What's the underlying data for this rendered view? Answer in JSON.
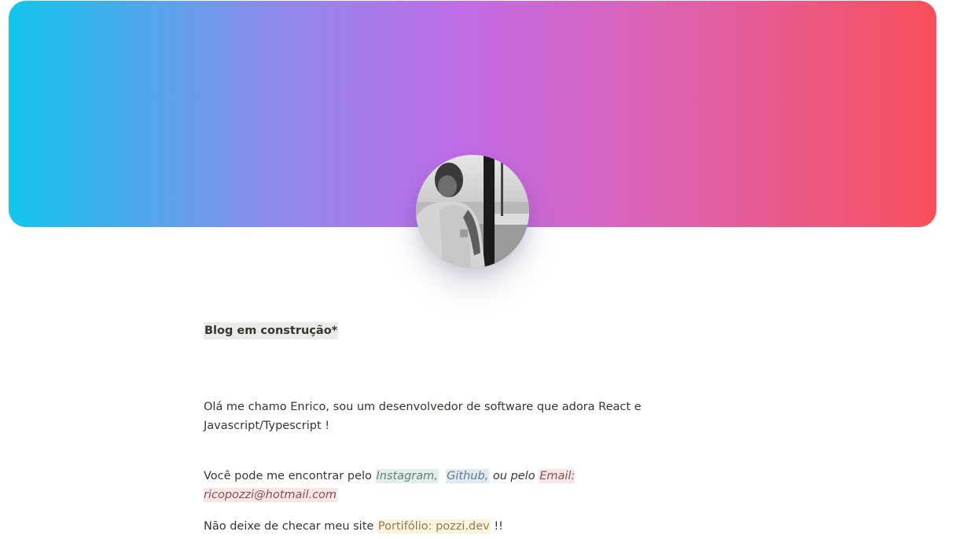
{
  "cover": {
    "colors": [
      "#12c6ec",
      "#c46be6",
      "#f84f5a"
    ]
  },
  "avatar": {
    "alt_icon": "profile-photo"
  },
  "heading": "Blog em construção*",
  "intro": {
    "line1": "Olá me chamo Enrico, sou um desenvolvedor de software que adora React e",
    "line2": "Javascript/Typescript !"
  },
  "contact": {
    "prefix": "Você pode me encontrar pelo ",
    "instagram": "Instagram,",
    "github": "Github,",
    "or_text": " ou pelo ",
    "email": "Email: ricopozzi@hotmail.com"
  },
  "portfolio": {
    "prefix": "Não deixe de checar meu site ",
    "link": "Portifólio: pozzi.dev",
    "suffix": " !!"
  }
}
